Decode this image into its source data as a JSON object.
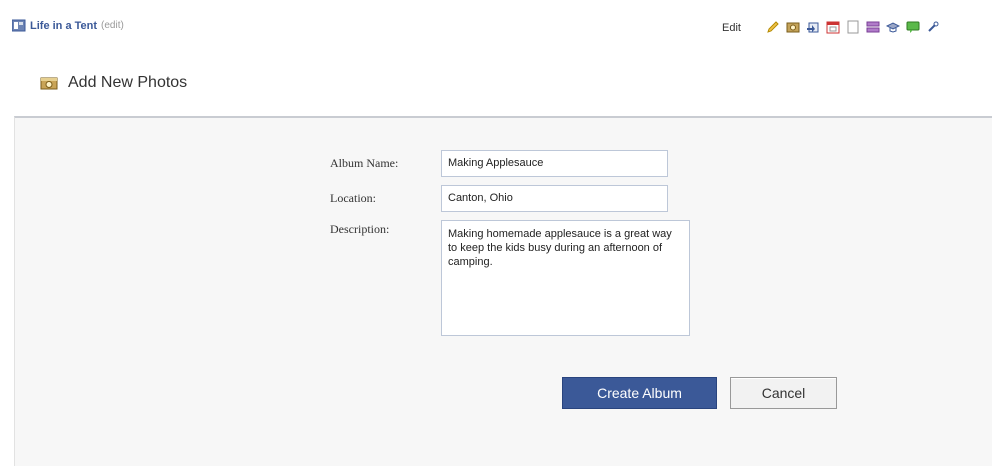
{
  "header": {
    "page_name": "Life in a Tent",
    "edit_link": "(edit)",
    "edit_label": "Edit",
    "toolbar_icons": [
      "pencil-icon",
      "photo-icon",
      "share-icon",
      "calendar-icon",
      "note-icon",
      "list-icon",
      "gift-icon",
      "chat-icon",
      "link-icon"
    ]
  },
  "section": {
    "title": "Add New Photos",
    "icon": "camera-icon"
  },
  "form": {
    "album_name_label": "Album Name:",
    "album_name_value": "Making Applesauce",
    "location_label": "Location:",
    "location_value": "Canton, Ohio",
    "description_label": "Description:",
    "description_value": "Making homemade applesauce is a great way to keep the kids busy during an afternoon of camping.",
    "create_button": "Create Album",
    "cancel_button": "Cancel"
  },
  "colors": {
    "brand_blue": "#3b5998",
    "panel_bg": "#f7f7f7",
    "input_border": "#bdc7d8"
  }
}
